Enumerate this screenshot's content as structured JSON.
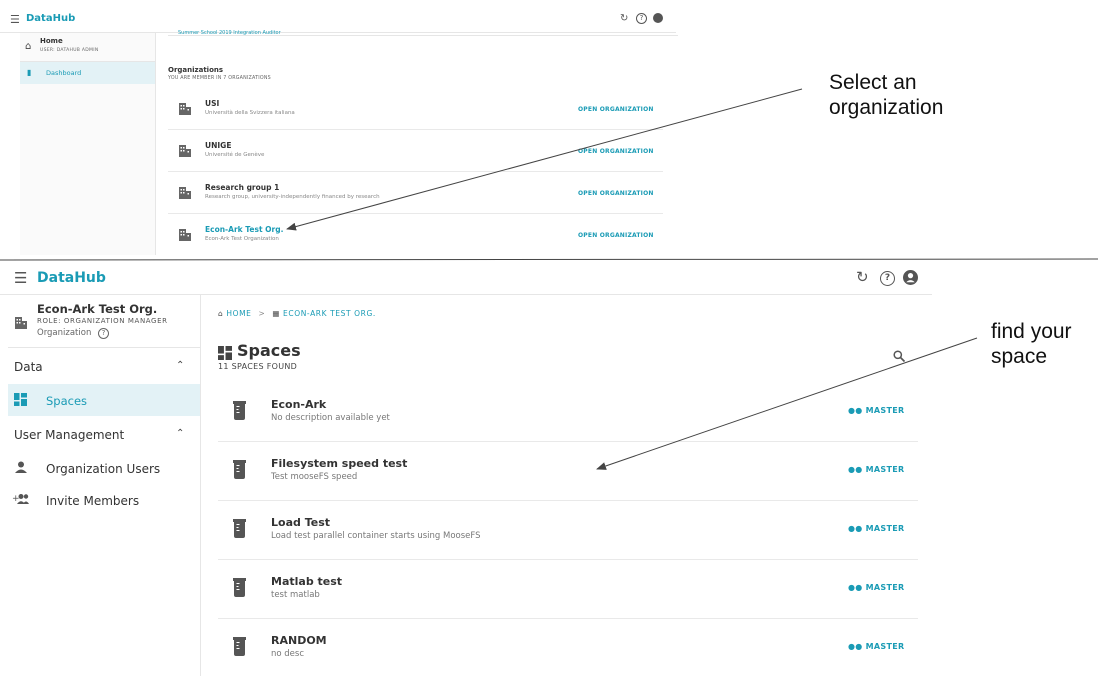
{
  "top": {
    "brand": "DataHub",
    "home_label": "Home",
    "user_label": "USER: DATAHUB ADMIN",
    "dashboard_label": "Dashboard",
    "cropped_line": "Summer School 2019   Integration   Auditor",
    "orgs_title": "Organizations",
    "orgs_subtitle": "YOU ARE MEMBER IN 7 ORGANIZATIONS",
    "orgs": [
      {
        "name": "USI",
        "desc": "Università della Svizzera italiana",
        "action": "OPEN ORGANIZATION"
      },
      {
        "name": "UNIGE",
        "desc": "Université de Genève",
        "action": "OPEN ORGANIZATION"
      },
      {
        "name": "Research group 1",
        "desc": "Research group, university-independently financed by research",
        "action": "OPEN ORGANIZATION"
      },
      {
        "name": "Econ-Ark Test Org.",
        "desc": "Econ-Ark Test Organization",
        "action": "OPEN ORGANIZATION"
      }
    ]
  },
  "bottom": {
    "brand": "DataHub",
    "org_name": "Econ-Ark Test Org.",
    "role": "ROLE: ORGANIZATION MANAGER",
    "org_type": "Organization",
    "section_data": "Data",
    "spaces_label": "Spaces",
    "section_users": "User Management",
    "org_users_label": "Organization Users",
    "invite_label": "Invite Members",
    "breadcrumb_home": "HOME",
    "breadcrumb_sep": ">",
    "breadcrumb_org": "ECON-ARK TEST ORG.",
    "page_title": "Spaces",
    "spaces_count": "11 SPACES FOUND",
    "spaces": [
      {
        "name": "Econ-Ark",
        "desc": "No description available yet",
        "badge": "MASTER"
      },
      {
        "name": "Filesystem speed test",
        "desc": "Test mooseFS speed",
        "badge": "MASTER"
      },
      {
        "name": "Load Test",
        "desc": "Load test parallel container starts using MooseFS",
        "badge": "MASTER"
      },
      {
        "name": "Matlab test",
        "desc": "test matlab",
        "badge": "MASTER"
      },
      {
        "name": "RANDOM",
        "desc": "no desc",
        "badge": "MASTER"
      }
    ]
  },
  "annotations": {
    "select_line1": "Select an",
    "select_line2": "organization",
    "find_line1": "find your",
    "find_line2": "space"
  },
  "colors": {
    "accent": "#1a9bb5",
    "text": "#333333",
    "selected_bg": "#e3f2f6"
  }
}
